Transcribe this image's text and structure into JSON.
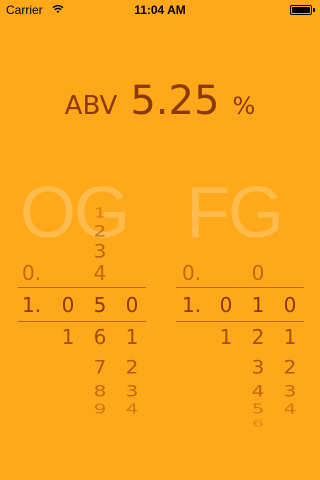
{
  "status_bar": {
    "carrier": "Carrier",
    "time": "11:04 AM",
    "icons": [
      "wifi-icon",
      "battery-icon"
    ]
  },
  "readout": {
    "label": "ABV",
    "value": "5.25",
    "unit": "%"
  },
  "og": {
    "header": "OG",
    "above_prefix": "0.",
    "prefix": "1.",
    "columns": [
      {
        "above": [],
        "selected": "0",
        "below": []
      },
      {
        "above": [
          "1",
          "2",
          "3",
          "4"
        ],
        "selected": "5",
        "below": [
          "6",
          "7",
          "8",
          "9"
        ]
      },
      {
        "above": [],
        "selected": "0",
        "below": [
          "1",
          "2",
          "3",
          "4"
        ]
      }
    ],
    "second_col_below": [
      "1"
    ]
  },
  "fg": {
    "header": "FG",
    "above_prefix": "0.",
    "prefix": "1.",
    "columns": [
      {
        "above": [],
        "selected": "0",
        "below": [
          "1"
        ]
      },
      {
        "above": [
          "0"
        ],
        "selected": "1",
        "below": [
          "2",
          "3",
          "4",
          "5",
          "6"
        ]
      },
      {
        "above": [],
        "selected": "0",
        "below": [
          "1",
          "2",
          "3",
          "4"
        ]
      }
    ]
  },
  "colors": {
    "background": "#FFA81A",
    "text": "#8A3A08",
    "header_overlay": "rgba(255,255,255,0.22)"
  }
}
